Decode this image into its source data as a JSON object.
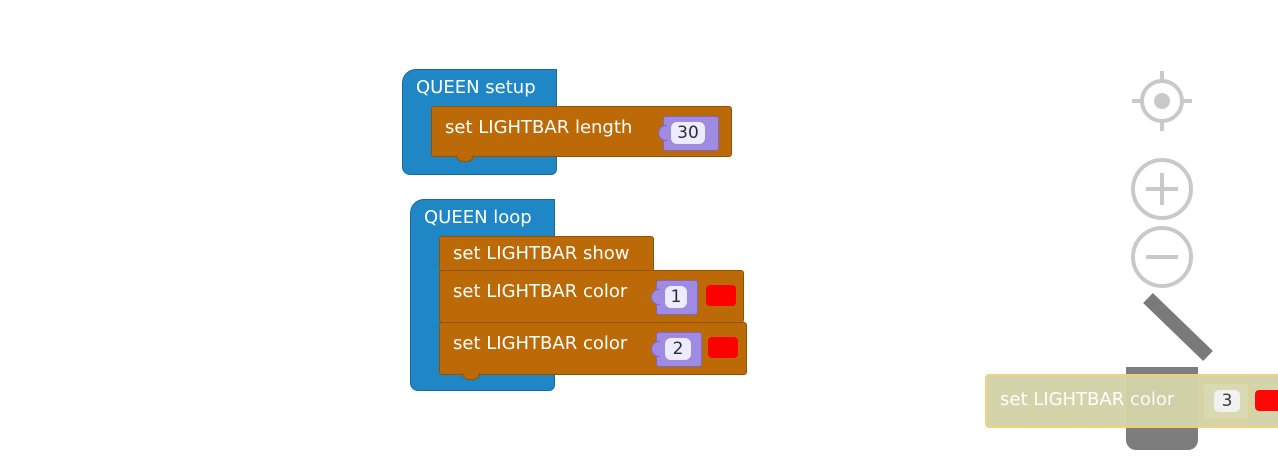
{
  "workspace": {
    "setup_block": {
      "label": "QUEEN setup",
      "statement": {
        "label": "set LIGHTBAR length",
        "value": "30"
      }
    },
    "loop_block": {
      "label": "QUEEN loop",
      "statements": [
        {
          "label": "set LIGHTBAR show"
        },
        {
          "label": "set LIGHTBAR color",
          "value": "1",
          "color": "#ff0000"
        },
        {
          "label": "set LIGHTBAR color",
          "value": "2",
          "color": "#ff0000"
        }
      ]
    },
    "dragged_block": {
      "label": "set LIGHTBAR color",
      "value": "3",
      "color": "#ff0000"
    }
  },
  "controls": {
    "recenter": "crosshair-icon",
    "zoom_in": "plus-icon",
    "zoom_out": "minus-icon",
    "trash": "trash-icon"
  },
  "colors": {
    "event_block": "#1f87c6",
    "action_block": "#bb6a07",
    "value_slot": "#9f8be2",
    "swatch": "#ff0000",
    "dragged_block": "#d3d3a8"
  }
}
